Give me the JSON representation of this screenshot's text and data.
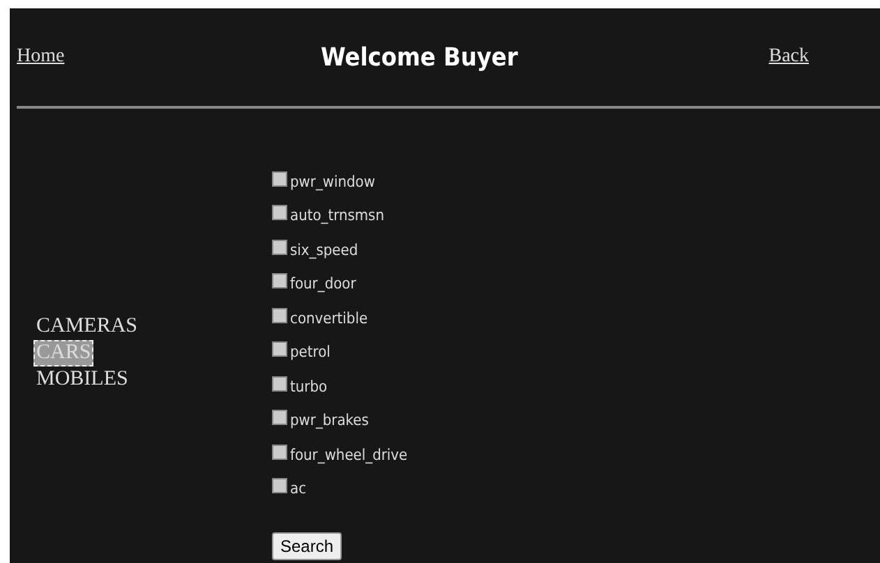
{
  "header": {
    "home_link": "Home",
    "title": "Welcome Buyer",
    "back_link": "Back"
  },
  "categories": [
    {
      "label": "CAMERAS",
      "selected": false
    },
    {
      "label": "CARS",
      "selected": true
    },
    {
      "label": "MOBILES",
      "selected": false
    }
  ],
  "features": [
    {
      "label": "pwr_window",
      "checked": false
    },
    {
      "label": "auto_trnsmsn",
      "checked": false
    },
    {
      "label": "six_speed",
      "checked": false
    },
    {
      "label": "four_door",
      "checked": false
    },
    {
      "label": "convertible",
      "checked": false
    },
    {
      "label": "petrol",
      "checked": false
    },
    {
      "label": "turbo",
      "checked": false
    },
    {
      "label": "pwr_brakes",
      "checked": false
    },
    {
      "label": "four_wheel_drive",
      "checked": false
    },
    {
      "label": "ac",
      "checked": false
    }
  ],
  "search_button": "Search"
}
